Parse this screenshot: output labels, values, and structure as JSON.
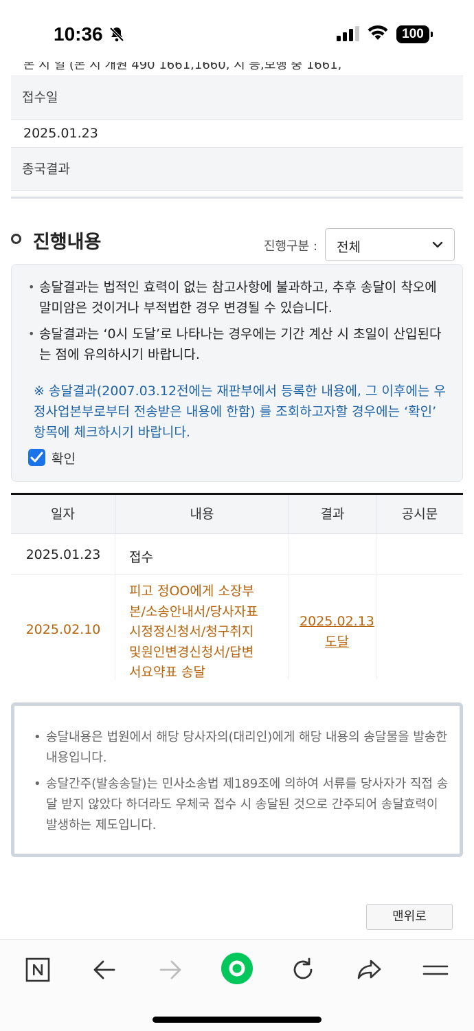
{
  "status_bar": {
    "time": "10:36",
    "battery": "100"
  },
  "info": {
    "cut_text": "본 시 일 (본 시 개원 490 1661,1660, 시 등,보행 중 1661,",
    "receipt_label": "접수일",
    "receipt_value": "2025.01.23",
    "final_result_label": "종국결과"
  },
  "progress": {
    "title": "진행내용",
    "filter_label": "진행구분 :",
    "filter_value": "전체"
  },
  "notice": {
    "item1": "송달결과는 법적인 효력이 없는 참고사항에 불과하고, 추후 송달이 착오에 말미암은 것이거나 부적법한 경우 변경될 수 있습니다.",
    "item2": "송달결과는 ‘0시 도달’로 나타나는 경우에는 기간 계산 시 초일이 산입된다는 점에 유의하시기 바랍니다.",
    "blue_note": "※ 송달결과(2007.03.12전에는 재판부에서 등록한 내용에, 그 이후에는 우정사업본부로부터 전송받은 내용에 한함) 를 조회하고자할 경우에는 ‘확인’ 항목에 체크하시기 바랍니다.",
    "checkbox_label": "확인"
  },
  "table": {
    "headers": [
      "일자",
      "내용",
      "결과",
      "공시문"
    ],
    "rows": [
      {
        "date": "2025.01.23",
        "content": "접수",
        "result": "",
        "notice": ""
      },
      {
        "date": "2025.02.10",
        "content_lines": [
          "피고 정OO에게 소장부",
          "본/소송안내서/당사자표",
          "시정정신청서/청구취지",
          "및원인변경신청서/답변",
          "서요약표 송달"
        ],
        "result_lines": [
          "2025.02.13",
          "도달"
        ],
        "notice": ""
      }
    ]
  },
  "definitions": {
    "item1": "송달내용은 법원에서 해당 당사자의(대리인)에게 해당 내용의 송달물을 발송한 내용입니다.",
    "item2": "송달간주(발송송달)는 민사소송법 제189조에 의하여 서류를 당사자가 직접 송달 받지 않았다 하더라도 우체국 접수 시 송달된 것으로 간주되어 송달효력이 발생하는 제도입니다."
  },
  "top_button": "맨위로",
  "toolbar_icons": [
    "naver-n-icon",
    "back-arrow-icon",
    "forward-arrow-icon",
    "green-dot-icon",
    "reload-icon",
    "share-icon",
    "menu-icon"
  ],
  "colors": {
    "orange": "#b8640c",
    "blue_note": "#1d63a8",
    "checkbox": "#1a73e8",
    "green": "#03c75a"
  }
}
